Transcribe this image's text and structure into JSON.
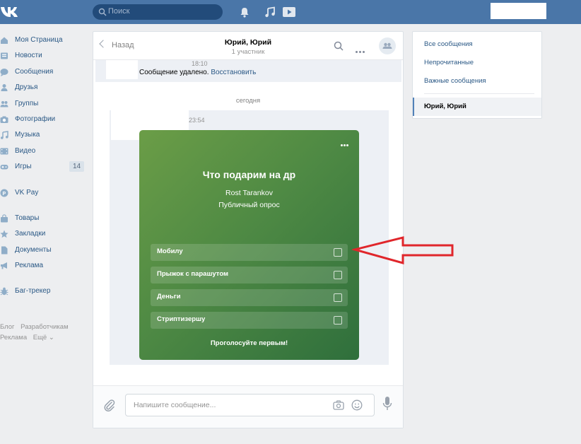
{
  "header": {
    "search_placeholder": "Поиск",
    "accent": "#4a76a8"
  },
  "nav": {
    "items": [
      {
        "label": "Моя Страница",
        "icon": "home-icon"
      },
      {
        "label": "Новости",
        "icon": "news-icon"
      },
      {
        "label": "Сообщения",
        "icon": "messages-icon"
      },
      {
        "label": "Друзья",
        "icon": "friends-icon"
      },
      {
        "label": "Группы",
        "icon": "groups-icon"
      },
      {
        "label": "Фотографии",
        "icon": "camera-icon"
      },
      {
        "label": "Музыка",
        "icon": "music-icon"
      },
      {
        "label": "Видео",
        "icon": "video-icon"
      },
      {
        "label": "Игры",
        "icon": "gamepad-icon",
        "badge": "14"
      },
      {
        "label": "VK Pay",
        "icon": "vkpay-icon"
      },
      {
        "label": "Товары",
        "icon": "bag-icon"
      },
      {
        "label": "Закладки",
        "icon": "star-icon"
      },
      {
        "label": "Документы",
        "icon": "document-icon"
      },
      {
        "label": "Реклама",
        "icon": "megaphone-icon"
      },
      {
        "label": "Баг-трекер",
        "icon": "bug-icon"
      }
    ],
    "footer": [
      "Блог",
      "Разработчикам",
      "Реклама",
      "Ещё ⌄"
    ]
  },
  "chat": {
    "back_label": "Назад",
    "title": "Юрий, Юрий",
    "subtitle": "1 участник",
    "deleted_time": "18:10",
    "deleted_text": "Сообщение удалено.",
    "restore_link": "Восстановить",
    "day_label": "сегодня",
    "msg_time": "23:54",
    "poll": {
      "title": "Что подарим на др",
      "author": "Rost Tarankov",
      "type": "Публичный опрос",
      "options": [
        "Мобилу",
        "Прыжок с парашутом",
        "Деньги",
        "Стриптизершу"
      ],
      "footer": "Проголосуйте первым!"
    },
    "composer_placeholder": "Напишите сообщение..."
  },
  "right": {
    "all": "Все сообщения",
    "unread": "Непрочитанные",
    "important": "Важные сообщения",
    "active": "Юрий, Юрий"
  }
}
